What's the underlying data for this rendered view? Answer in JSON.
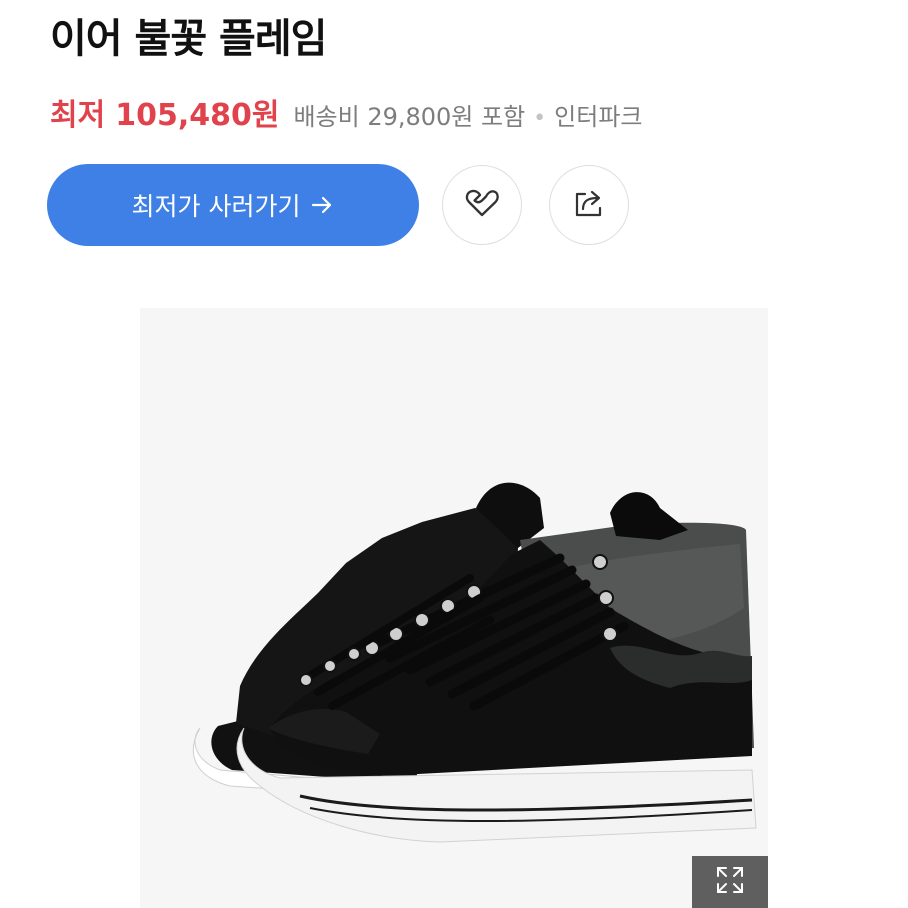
{
  "product": {
    "title": "이어 불꽃 플레임"
  },
  "price": {
    "label": "최저",
    "value": "105,480원",
    "shipping": "배송비 29,800원 포함",
    "separator": "•",
    "seller": "인터파크"
  },
  "actions": {
    "buy_label": "최저가 사러가기"
  },
  "icons": {
    "arrow": "arrow-right-icon",
    "like": "heart-icon",
    "share": "share-icon",
    "expand": "expand-icon"
  },
  "colors": {
    "price_red": "#e0434b",
    "button_blue": "#3f80e6",
    "muted_text": "#7d7d7d"
  }
}
